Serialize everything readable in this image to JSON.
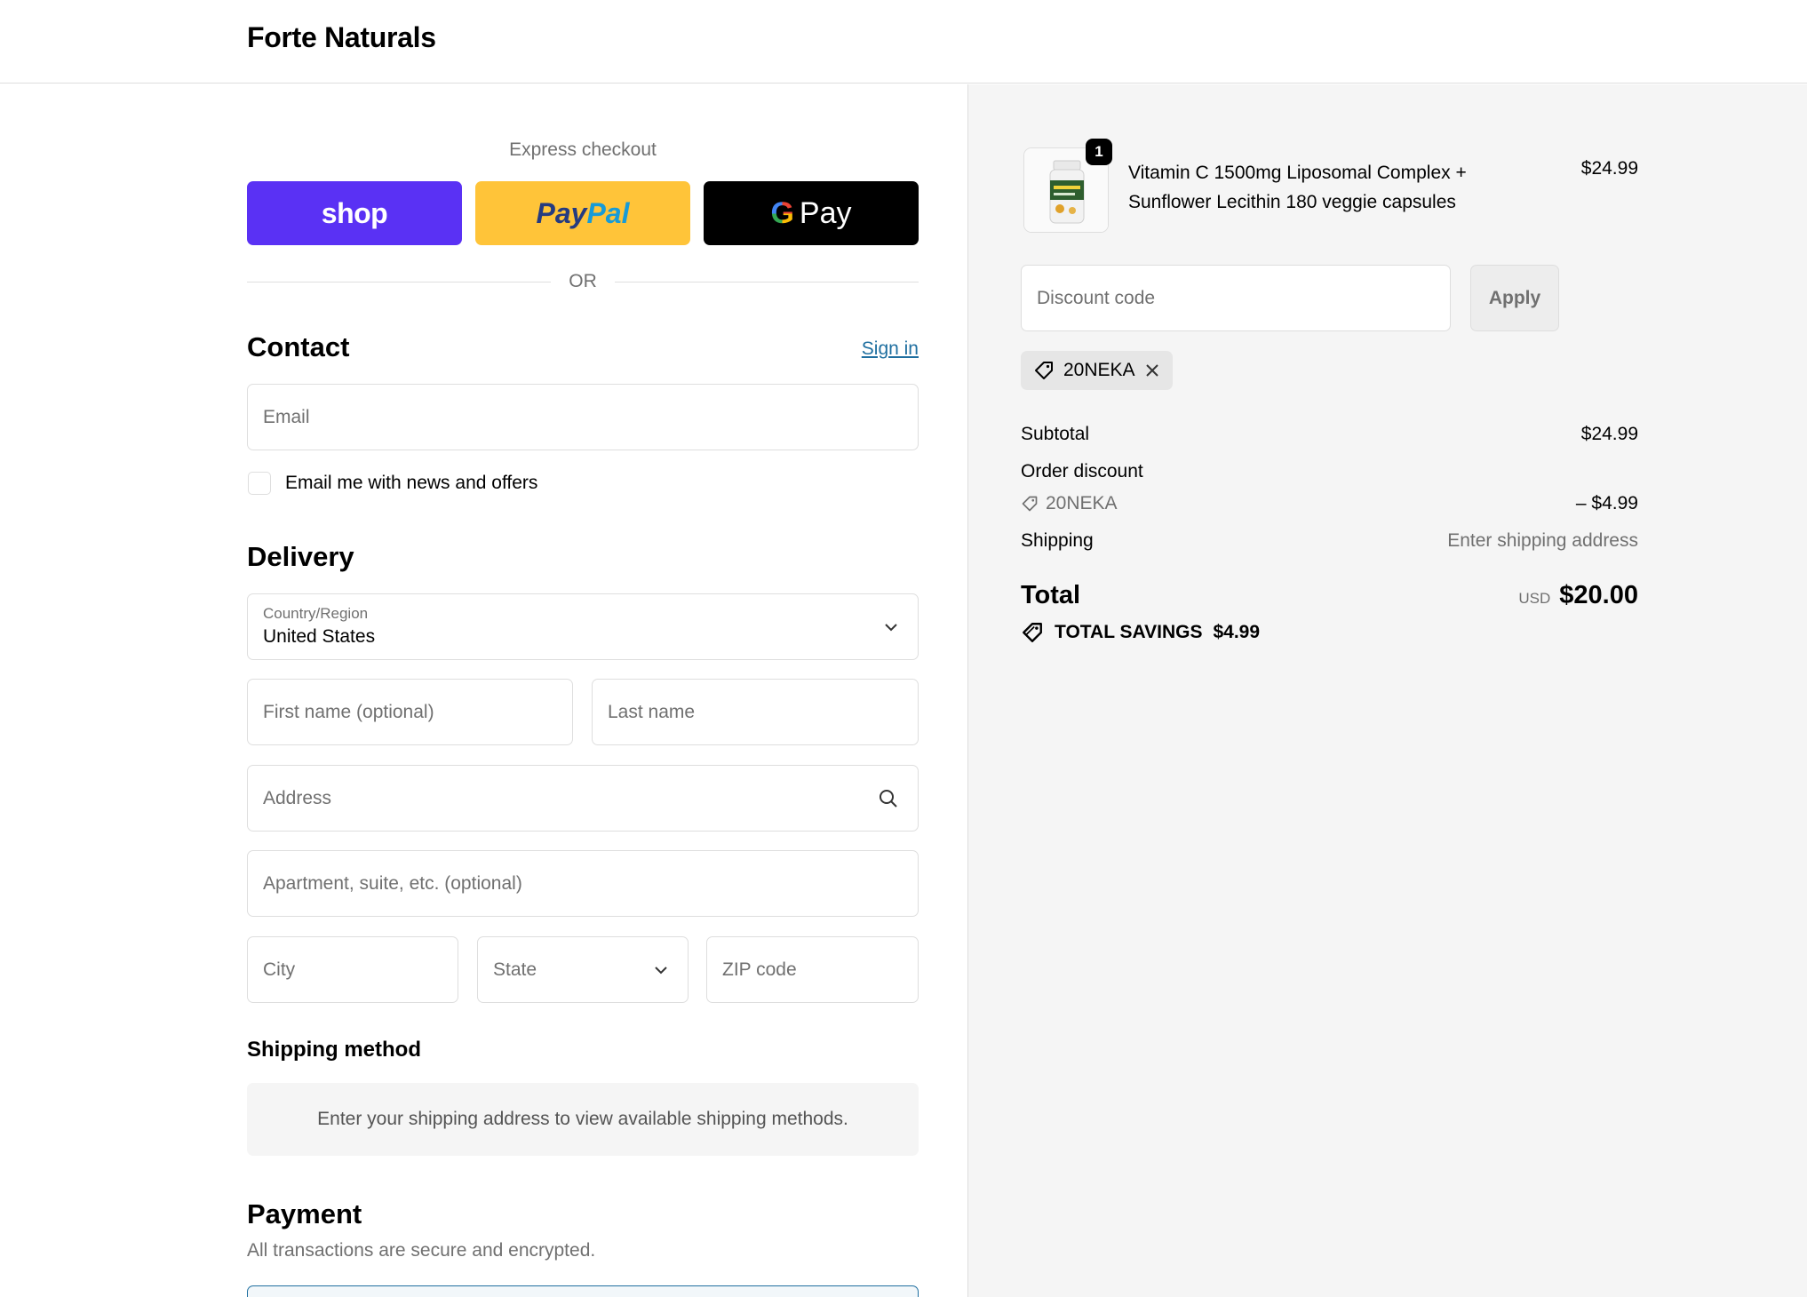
{
  "header": {
    "brand": "Forte Naturals"
  },
  "express": {
    "label": "Express checkout",
    "shop_label": "shop",
    "paypal_part1": "Pay",
    "paypal_part2": "Pal",
    "gpay_g": "G",
    "gpay_label": "Pay",
    "or_label": "OR"
  },
  "contact": {
    "title": "Contact",
    "sign_in": "Sign in",
    "email_placeholder": "Email",
    "news_label": "Email me with news and offers"
  },
  "delivery": {
    "title": "Delivery",
    "country_label": "Country/Region",
    "country_value": "United States",
    "first_name_placeholder": "First name (optional)",
    "last_name_placeholder": "Last name",
    "address_placeholder": "Address",
    "apartment_placeholder": "Apartment, suite, etc. (optional)",
    "city_placeholder": "City",
    "state_placeholder": "State",
    "zip_placeholder": "ZIP code"
  },
  "shipping_method": {
    "title": "Shipping method",
    "info": "Enter your shipping address to view available shipping methods."
  },
  "payment": {
    "title": "Payment",
    "subtitle": "All transactions are secure and encrypted."
  },
  "order": {
    "item": {
      "quantity": "1",
      "name_line1": "Vitamin C 1500mg Liposomal Complex +",
      "name_line2": "Sunflower Lecithin 180 veggie capsules",
      "price": "$24.99"
    },
    "discount_placeholder": "Discount code",
    "apply_label": "Apply",
    "applied_code": "20NEKA",
    "subtotal_label": "Subtotal",
    "subtotal_value": "$24.99",
    "order_discount_label": "Order discount",
    "discount_code": "20NEKA",
    "discount_value": "– $4.99",
    "shipping_label": "Shipping",
    "shipping_value": "Enter shipping address",
    "total_label": "Total",
    "currency": "USD",
    "total_value": "$20.00",
    "savings_label": "TOTAL SAVINGS",
    "savings_value": "$4.99"
  },
  "colors": {
    "shop_purple": "#5a31f4",
    "paypal_yellow": "#ffc439",
    "link_blue": "#1f6fa0"
  }
}
